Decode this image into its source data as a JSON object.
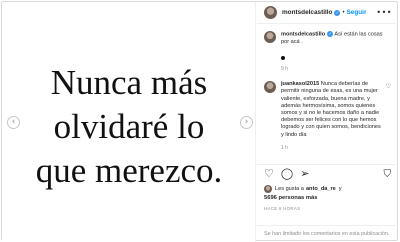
{
  "post": {
    "quote_lines": [
      "Nunca más",
      "olvidaré lo",
      "que merezco."
    ],
    "arrows": {
      "left": "‹",
      "right": "›"
    }
  },
  "header": {
    "username": "montsdelcastillo",
    "verified_glyph": "✓",
    "separator": "•",
    "follow_label": "Seguir",
    "more_glyph": "•••"
  },
  "caption": {
    "username": "montsdelcastillo",
    "verified_glyph": "✓",
    "text": " Así están las cosas por acá .",
    "time": "9 h"
  },
  "comment": {
    "username": "juankasol2015",
    "text": " Nunca deberías de permitir ninguna de esas, es una mujer valiente, esforzada, buena madre, y además hermosísima, somos quienes somos y si no le hacemos daño a nadie debemos ser felices con lo que hemos logrado y con quien somos, bendiciones y lindo día",
    "time": "1 h",
    "like_glyph": "♡"
  },
  "actions": {
    "like_icon": "heart-icon",
    "like_glyph": "♡",
    "comment_glyph": "◯",
    "share_glyph": "➢",
    "bookmark_glyph": "⛉"
  },
  "likes": {
    "liked_by_prefix": "Les gusta a",
    "liked_by_user": "anto_da_re",
    "liked_by_suffix": "y",
    "count_text": "5696 personas más"
  },
  "timestamp": "HACE 9 HORAS",
  "footer": "Se han limitado los comentarios en esta publicación.",
  "colors": {
    "accent": "#0095f6",
    "verified": "#3897f0",
    "muted": "#8e8e8e"
  }
}
